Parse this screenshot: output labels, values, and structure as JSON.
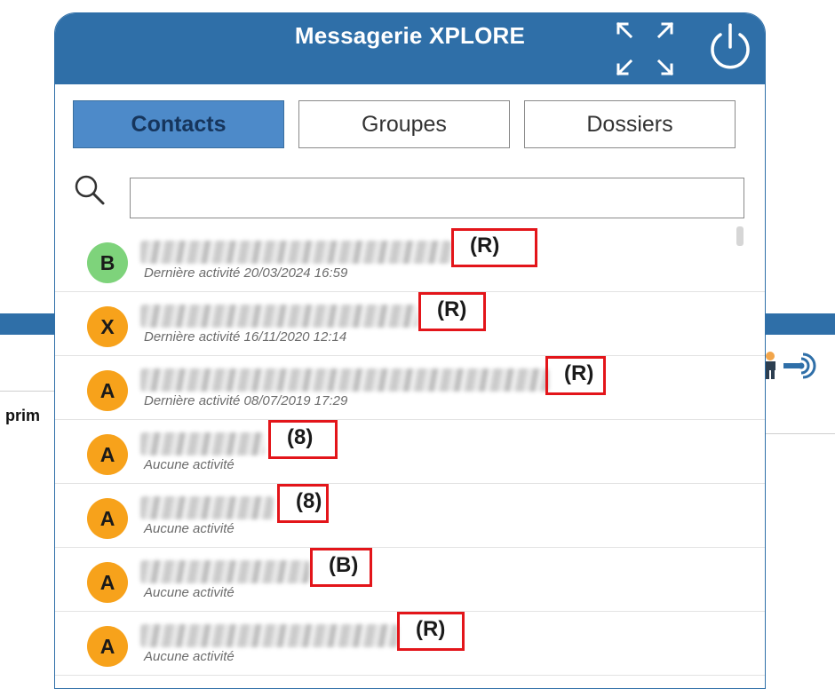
{
  "background": {
    "partial_text": "prim"
  },
  "header": {
    "title": "Messagerie XPLORE",
    "expand_icon": "expand-arrows-icon",
    "power_icon": "power-icon"
  },
  "tabs": [
    {
      "label": "Contacts",
      "active": true
    },
    {
      "label": "Groupes",
      "active": false
    },
    {
      "label": "Dossiers",
      "active": false
    }
  ],
  "search": {
    "value": "",
    "placeholder": ""
  },
  "contacts": [
    {
      "initial": "B",
      "avatar_color": "#7ed37b",
      "tag": "(R)",
      "activity": "Dernière activité 20/03/2024 16:59"
    },
    {
      "initial": "X",
      "avatar_color": "#f7a21b",
      "tag": "(R)",
      "activity": "Dernière activité 16/11/2020 12:14"
    },
    {
      "initial": "A",
      "avatar_color": "#f7a21b",
      "tag": "(R)",
      "activity": "Dernière activité 08/07/2019 17:29"
    },
    {
      "initial": "A",
      "avatar_color": "#f7a21b",
      "tag": "(8)",
      "activity": "Aucune activité"
    },
    {
      "initial": "A",
      "avatar_color": "#f7a21b",
      "tag": "(8)",
      "activity": "Aucune activité"
    },
    {
      "initial": "A",
      "avatar_color": "#f7a21b",
      "tag": "(B)",
      "activity": "Aucune activité"
    },
    {
      "initial": "A",
      "avatar_color": "#f7a21b",
      "tag": "(R)",
      "activity": "Aucune activité"
    }
  ],
  "colors": {
    "header": "#2f6fa8",
    "active_tab": "#4d8ac9",
    "highlight_box": "#e3151a"
  }
}
